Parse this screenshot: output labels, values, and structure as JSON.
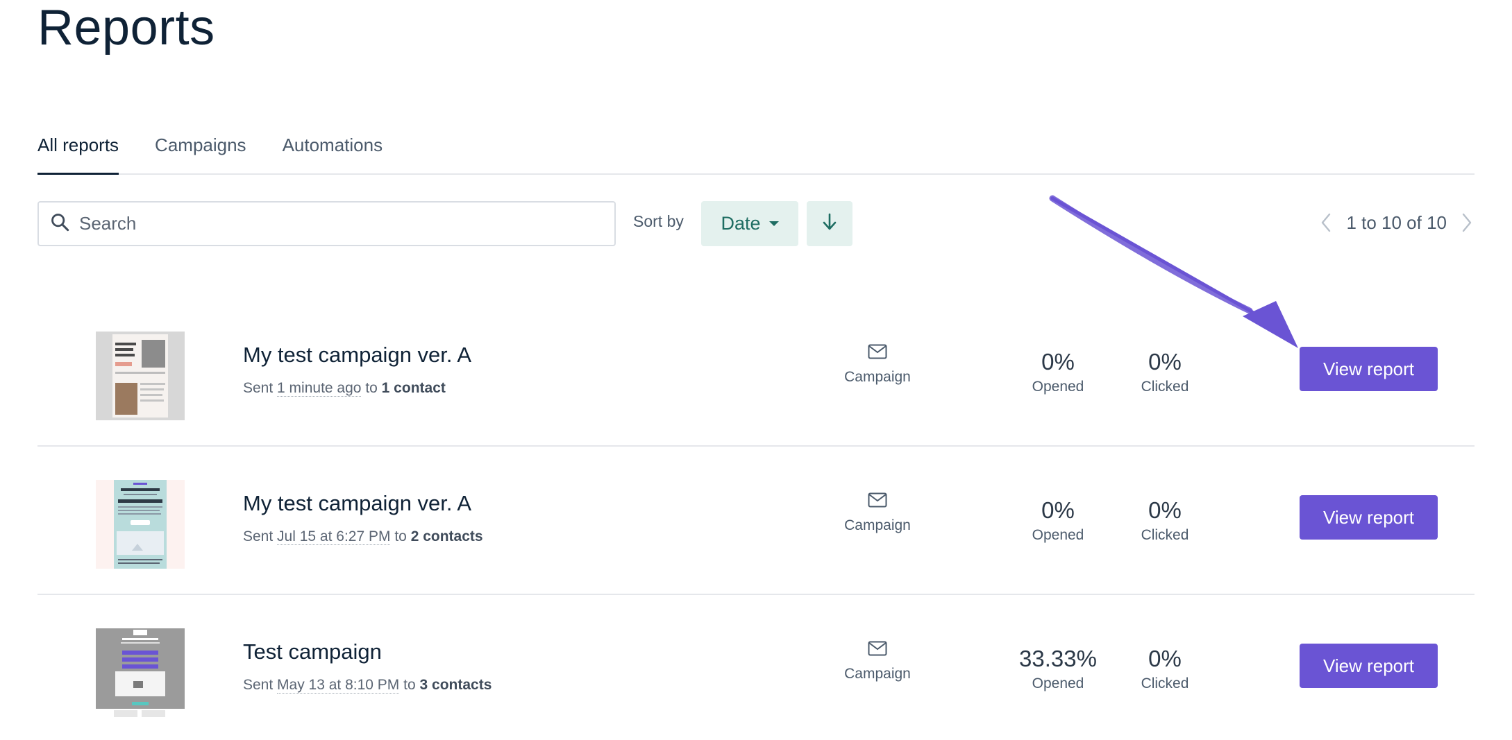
{
  "page": {
    "title": "Reports"
  },
  "tabs": [
    {
      "label": "All reports",
      "active": true
    },
    {
      "label": "Campaigns",
      "active": false
    },
    {
      "label": "Automations",
      "active": false
    }
  ],
  "toolbar": {
    "search_placeholder": "Search",
    "sort_label": "Sort by",
    "sort_value": "Date",
    "sort_direction_icon": "arrow-down-icon"
  },
  "pagination": {
    "text": "1 to 10 of 10"
  },
  "rows": [
    {
      "title": "My test campaign ver. A",
      "sent_prefix": "Sent",
      "sent_time": "1 minute ago",
      "sent_to_word": "to",
      "recipients": "1 contact",
      "type_label": "Campaign",
      "opened_value": "0%",
      "opened_label": "Opened",
      "clicked_value": "0%",
      "clicked_label": "Clicked",
      "button_label": "View report"
    },
    {
      "title": "My test campaign ver. A",
      "sent_prefix": "Sent",
      "sent_time": "Jul 15 at 6:27 PM",
      "sent_to_word": "to",
      "recipients": "2 contacts",
      "type_label": "Campaign",
      "opened_value": "0%",
      "opened_label": "Opened",
      "clicked_value": "0%",
      "clicked_label": "Clicked",
      "button_label": "View report"
    },
    {
      "title": "Test campaign",
      "sent_prefix": "Sent",
      "sent_time": "May 13 at 8:10 PM",
      "sent_to_word": "to",
      "recipients": "3 contacts",
      "type_label": "Campaign",
      "opened_value": "33.33%",
      "opened_label": "Opened",
      "clicked_value": "0%",
      "clicked_label": "Clicked",
      "button_label": "View report"
    }
  ],
  "colors": {
    "accent": "#6a54d4",
    "sort_bg": "#e4f1ee",
    "sort_text": "#1e6d62",
    "title": "#0f2236"
  }
}
